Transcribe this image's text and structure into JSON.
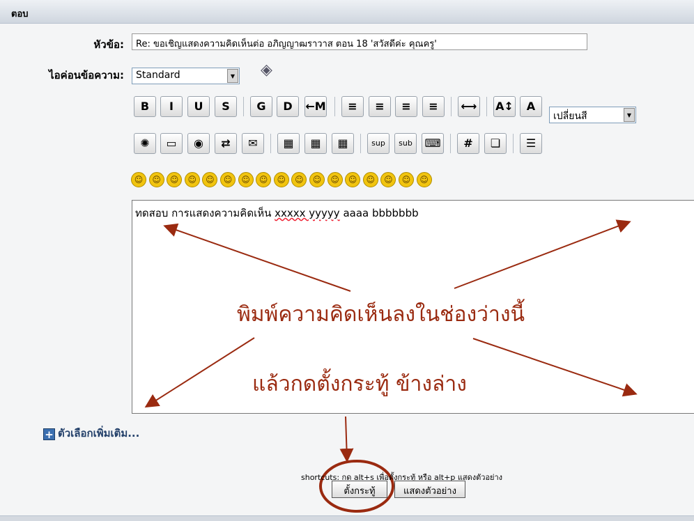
{
  "header": {
    "title": "ตอบ"
  },
  "form": {
    "subject_label": "หัวข้อ:",
    "subject_value": "Re: ขอเชิญแสดงความคิดเห็นต่อ อภิญญาฒราวาส ตอน  18 'สวัสดีค่ะ คุณครู'",
    "icon_label": "ไอค่อนข้อความ:",
    "icon_select": "Standard",
    "color_select": "เปลี่ยนสี"
  },
  "toolbar": {
    "row1": [
      {
        "name": "bold-button",
        "glyph": "B"
      },
      {
        "name": "italic-button",
        "glyph": "I"
      },
      {
        "name": "underline-button",
        "glyph": "U"
      },
      {
        "name": "strike-button",
        "glyph": "S"
      },
      {
        "name": "glow-button",
        "glyph": "G"
      },
      {
        "name": "shadow-button",
        "glyph": "D"
      },
      {
        "name": "move-button",
        "glyph": "←M"
      },
      {
        "name": "pre-button",
        "glyph": "≡"
      },
      {
        "name": "align-left-button",
        "glyph": "≡"
      },
      {
        "name": "align-center-button",
        "glyph": "≡"
      },
      {
        "name": "align-right-button",
        "glyph": "≡"
      },
      {
        "name": "hr-button",
        "glyph": "⟷"
      },
      {
        "name": "font-size-button",
        "glyph": "A↕"
      },
      {
        "name": "font-color-button",
        "glyph": "A"
      }
    ],
    "row2": [
      {
        "name": "flash-button",
        "glyph": "✺"
      },
      {
        "name": "image-button",
        "glyph": "▭"
      },
      {
        "name": "url-button",
        "glyph": "◉"
      },
      {
        "name": "ftp-button",
        "glyph": "⇄"
      },
      {
        "name": "email-button",
        "glyph": "✉"
      },
      {
        "name": "table-button",
        "glyph": "▦"
      },
      {
        "name": "table-row-button",
        "glyph": "▦"
      },
      {
        "name": "table-col-button",
        "glyph": "▦"
      },
      {
        "name": "sup-button",
        "glyph": "sup"
      },
      {
        "name": "sub-button",
        "glyph": "sub"
      },
      {
        "name": "teletype-button",
        "glyph": "⌨"
      },
      {
        "name": "code-button",
        "glyph": "#"
      },
      {
        "name": "quote-button",
        "glyph": "❏"
      },
      {
        "name": "list-button",
        "glyph": "☰"
      }
    ],
    "smileys": [
      "☺",
      "☺",
      "☺",
      "☺",
      "☺",
      "☺",
      "☺",
      "☺",
      "☺",
      "☺",
      "☺",
      "☺",
      "☺",
      "☺",
      "☺",
      "☺",
      "☺"
    ]
  },
  "editor": {
    "text_normal": "ทดสอบ การแสดงความคิดเห็น  ",
    "text_squiggly": "xxxxx yyyyy",
    "text_tail": " aaaa bbbbbbb"
  },
  "annotations": {
    "line1": "พิมพ์ความคิดเห็นลงในช่องว่างนี้",
    "line2": "แล้วกดตั้งกระทู้ ข้างล่าง"
  },
  "more_options": "ตัวเลือกเพิ่มเติม...",
  "shortcuts": "shortcuts: กด alt+s เพื่อตั้งกระทู้ หรือ alt+p แสดงตัวอย่าง",
  "buttons": {
    "submit": "ตั้งกระทู้",
    "preview": "แสดงตัวอย่าง"
  },
  "colors": {
    "annotation": "#9a2a10",
    "header_gradient_top": "#eef1f5",
    "header_gradient_bottom": "#cfd6df"
  }
}
